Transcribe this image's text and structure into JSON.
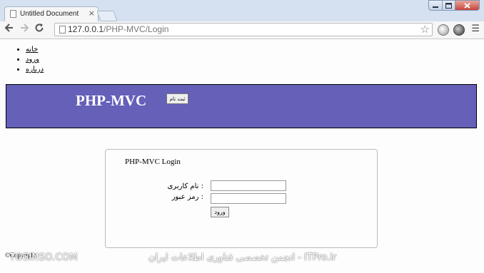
{
  "browser": {
    "tab_title": "Untitled Document",
    "tab_close": "×",
    "url_host": "127.0.0.1",
    "url_path": "/PHP-MVC/Login",
    "window_controls": [
      "minimize-icon",
      "maximize-icon",
      "close-icon"
    ]
  },
  "nav": {
    "items": [
      {
        "label": "خانه"
      },
      {
        "label": "ورود"
      },
      {
        "label": "درباره"
      }
    ]
  },
  "header": {
    "logo": "PHP-MVC",
    "register_label": "ثبت نام",
    "background_color": "#6560b8"
  },
  "login": {
    "title": "PHP-MVC Login",
    "username_label": "نام کاربری :",
    "password_label": "رمز عبور :",
    "username_value": "",
    "password_value": "",
    "submit_label": "ورود"
  },
  "footer": {
    "copyright": "©Copyright"
  },
  "watermark": {
    "left": "TOSINSO.COM",
    "right": "ITPro.ir - انجمن تخصصی فناوری اطلاعات ایران"
  }
}
